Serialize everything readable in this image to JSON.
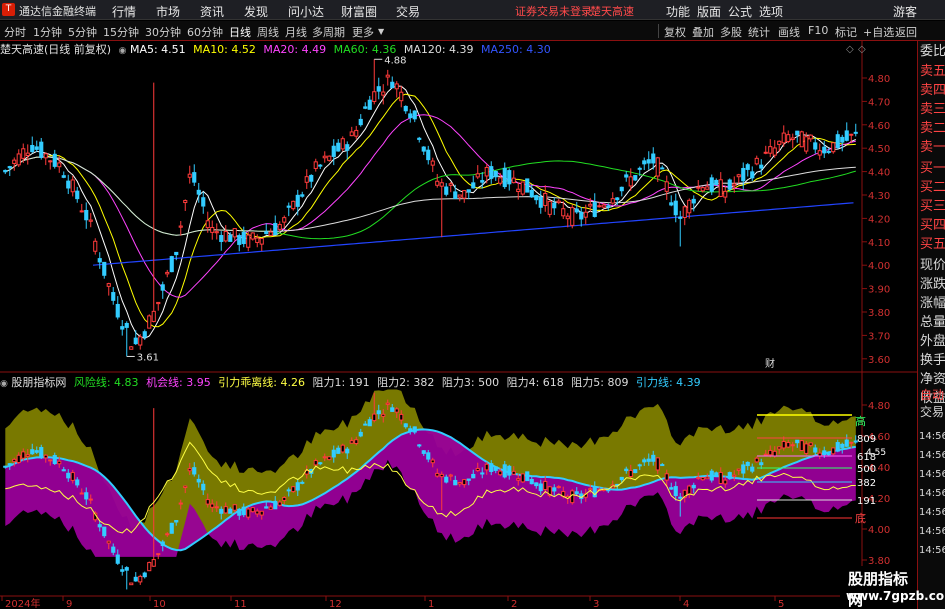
{
  "app": {
    "name": "通达信金融终端",
    "menu": [
      "行情",
      "市场",
      "资讯",
      "发现",
      "问小达",
      "财富圈",
      "交易"
    ],
    "warning": "证券交易未登录",
    "stock_link": "楚天高速",
    "right_menu": [
      "功能",
      "版面",
      "公式",
      "选项"
    ],
    "guest": "游客"
  },
  "toolbar": {
    "periods": [
      "分时",
      "1分钟",
      "5分钟",
      "15分钟",
      "30分钟",
      "60分钟",
      "日线",
      "周线",
      "月线",
      "多周期",
      "更多"
    ],
    "active_period": "日线",
    "right_buttons": [
      "复权",
      "叠加",
      "多股",
      "统计",
      "画线",
      "F10",
      "标记",
      "+自选",
      "返回"
    ]
  },
  "main_chart": {
    "title": "楚天高速(日线 前复权)",
    "ma": [
      {
        "label": "MA5: 4.51",
        "color": "#ffffff"
      },
      {
        "label": "MA10: 4.52",
        "color": "#ffff00"
      },
      {
        "label": "MA20: 4.49",
        "color": "#ff44ff"
      },
      {
        "label": "MA60: 4.36",
        "color": "#22dd22"
      },
      {
        "label": "MA120: 4.39",
        "color": "#dddddd"
      },
      {
        "label": "MA250: 4.30",
        "color": "#3355ff"
      }
    ],
    "y_ticks": [
      "4.80",
      "4.70",
      "4.60",
      "4.50",
      "4.40",
      "4.30",
      "4.20",
      "4.10",
      "4.00",
      "3.90",
      "3.80",
      "3.70",
      "3.60"
    ],
    "high_label": "4.88",
    "low_label": "3.61",
    "cai_label": "财"
  },
  "indicator": {
    "name": "股朋指标网",
    "items": [
      {
        "label": "风险线: 4.83",
        "color": "#22dd22"
      },
      {
        "label": "机会线: 3.95",
        "color": "#ff44ff"
      },
      {
        "label": "引力乖离线: 4.26",
        "color": "#ffff44"
      },
      {
        "label": "阻力1: 191",
        "color": "#dddddd"
      },
      {
        "label": "阻力2: 382",
        "color": "#dddddd"
      },
      {
        "label": "阻力3: 500",
        "color": "#dddddd"
      },
      {
        "label": "阻力4: 618",
        "color": "#dddddd"
      },
      {
        "label": "阻力5: 809",
        "color": "#dddddd"
      },
      {
        "label": "引力线: 4.39",
        "color": "#33ccff"
      }
    ],
    "y_ticks": [
      "4.80",
      "4.60",
      "4.40",
      "4.20",
      "4.00",
      "3.80"
    ],
    "levels": [
      "809",
      "618",
      "500",
      "382",
      "191"
    ],
    "high_tag": "高",
    "low_tag": "底",
    "price_tag": "4.55"
  },
  "x_axis": [
    "2024年",
    "9",
    "10",
    "11",
    "12",
    "1",
    "2",
    "3",
    "4",
    "5"
  ],
  "side_panel": [
    "委比",
    "卖五",
    "卖四",
    "卖三",
    "卖二",
    "卖一",
    "买一",
    "买二",
    "买三",
    "买四",
    "买五",
    "现价",
    "涨跌",
    "涨幅",
    "总量",
    "外盘",
    "换手",
    "净资",
    "收益"
  ],
  "time_panel": {
    "tabs": [
      "自动",
      "交易"
    ],
    "times": [
      "14:56",
      "14:56",
      "14:56",
      "14:56",
      "14:56",
      "14:56",
      "14:56"
    ]
  },
  "watermark": {
    "line1": "股朋指标网",
    "line2": "www.7gpzb.com"
  }
}
